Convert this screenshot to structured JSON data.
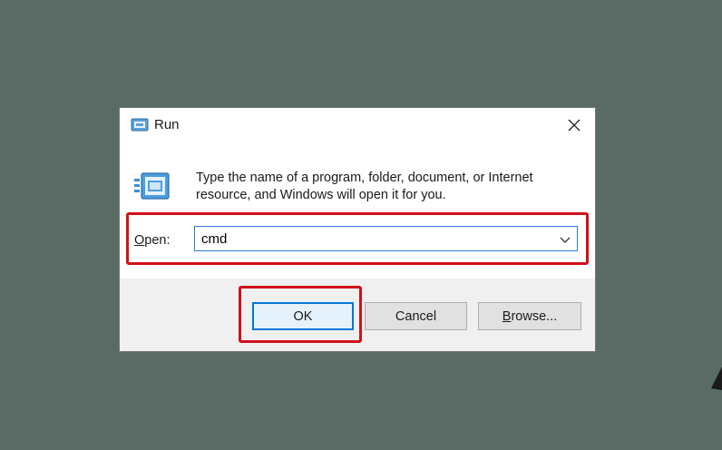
{
  "window": {
    "title": "Run",
    "close_icon": "close-icon",
    "title_icon": "run-app-icon"
  },
  "content": {
    "description": "Type the name of a program, folder, document, or Internet resource, and Windows will open it for you.",
    "open_label_accel": "O",
    "open_label_rest": "pen:",
    "open_value": "cmd",
    "dropdown_icon": "chevron-down-icon"
  },
  "buttons": {
    "ok": "OK",
    "cancel": "Cancel",
    "browse_accel": "B",
    "browse_rest": "rowse..."
  },
  "colors": {
    "desktop": "#5a6b66",
    "highlight": "#d0101a",
    "focus_blue": "#0078d7"
  }
}
